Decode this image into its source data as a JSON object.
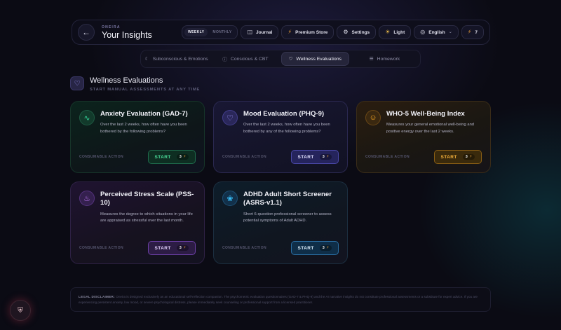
{
  "header": {
    "brand": "ONEIRA",
    "title": "Your Insights",
    "toggle": {
      "weekly": "WEEKLY",
      "monthly": "MONTHLY"
    },
    "journal": "Journal",
    "premium": "Premium Store",
    "settings": "Settings",
    "theme": "Light",
    "language": "English",
    "credits": "7"
  },
  "tabs": [
    {
      "label": "Subconscious & Emotions"
    },
    {
      "label": "Conscious & CBT"
    },
    {
      "label": "Wellness Evaluations"
    },
    {
      "label": "Homework"
    }
  ],
  "section": {
    "title": "Wellness Evaluations",
    "subtitle": "START MANUAL ASSESSMENTS AT ANY TIME"
  },
  "cards": [
    {
      "title": "Anxiety Evaluation (GAD-7)",
      "desc": "Over the last 2 weeks, how often have you been bothered by the following problems?",
      "footer": "CONSUMABLE ACTION",
      "button": "START",
      "cost": "3",
      "icon": "pulse-icon",
      "accent": "#34d399"
    },
    {
      "title": "Mood Evaluation (PHQ-9)",
      "desc": "Over the last 2 weeks, how often have you been bothered by any of the following problems?",
      "footer": "CONSUMABLE ACTION",
      "button": "START",
      "cost": "3",
      "icon": "heart-pulse-icon",
      "accent": "#a59bff"
    },
    {
      "title": "WHO-5 Well-Being Index",
      "desc": "Measures your general emotional well-being and positive energy over the last 2 weeks.",
      "footer": "CONSUMABLE ACTION",
      "button": "START",
      "cost": "3",
      "icon": "smile-icon",
      "accent": "#f5a623"
    },
    {
      "title": "Perceived Stress Scale (PSS-10)",
      "desc": "Measures the degree to which situations in your life are appraised as stressful over the last month.",
      "footer": "CONSUMABLE ACTION",
      "button": "START",
      "cost": "3",
      "icon": "flame-icon",
      "accent": "#c77dff"
    },
    {
      "title": "ADHD Adult Short Screener (ASRS-v1.1)",
      "desc": "Short 6-question professional screener to assess potential symptoms of Adult ADHD.",
      "footer": "CONSUMABLE ACTION",
      "button": "START",
      "cost": "3",
      "icon": "brain-icon",
      "accent": "#38bdf8"
    }
  ],
  "disclaimer": {
    "label": "LEGAL DISCLAIMER:",
    "text": "Oneira is designed exclusively as an educational self-reflection companion. The psychometric evaluation questionnaires (GAD-7 & PHQ-9) and the AI narrative insights do not constitute professional assessments or a substitute for expert advice. If you are experiencing persistent anxiety, low mood, or severe psychological distress, please immediately seek counseling or professional support from a licensed practitioner."
  }
}
